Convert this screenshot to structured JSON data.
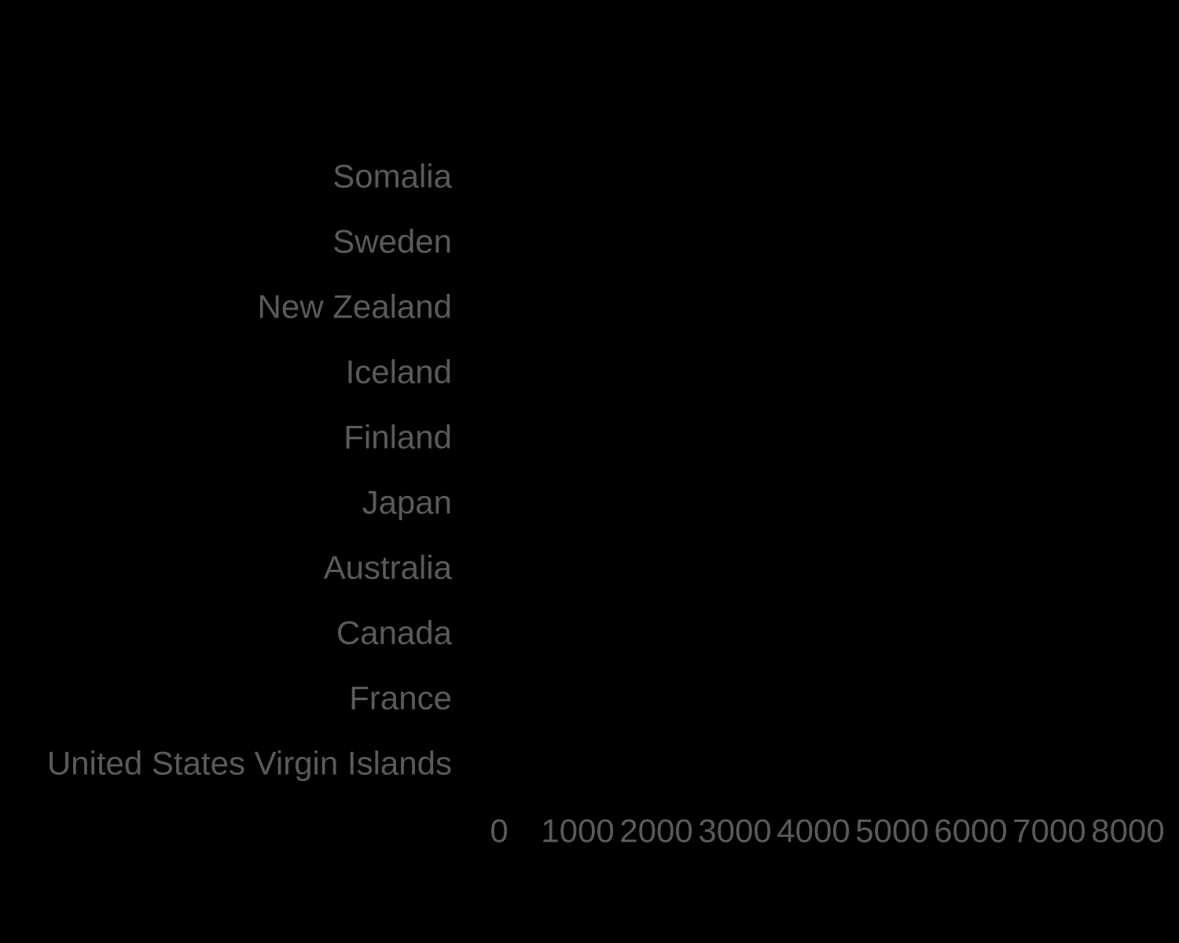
{
  "chart_data": {
    "type": "bar",
    "orientation": "horizontal",
    "categories": [
      "Somalia",
      "Sweden",
      "New Zealand",
      "Iceland",
      "Finland",
      "Japan",
      "Australia",
      "Canada",
      "France",
      "United States Virgin Islands"
    ],
    "values": [
      0,
      0,
      0,
      0,
      0,
      0,
      0,
      0,
      0,
      0
    ],
    "title": "",
    "xlabel": "",
    "ylabel": "",
    "xlim": [
      0,
      8000
    ],
    "xticks": [
      "0",
      "1000",
      "2000",
      "3000",
      "4000",
      "5000",
      "6000",
      "7000",
      "8000"
    ],
    "grid": false,
    "legend": "none",
    "colors": {
      "background": "#000000",
      "text": "#5a5a5a"
    }
  }
}
